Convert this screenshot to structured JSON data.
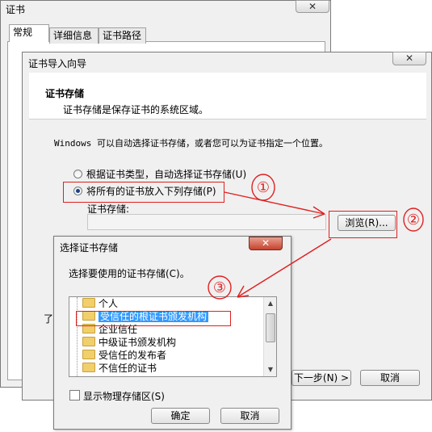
{
  "window_cert": {
    "title": "证书",
    "close_glyph": "✕",
    "tabs": [
      "常规",
      "详细信息",
      "证书路径"
    ]
  },
  "wizard": {
    "title": "证书导入向导",
    "close_glyph": "✕",
    "header_title": "证书存储",
    "header_desc": "证书存储是保存证书的系统区域。",
    "intro": "Windows 可以自动选择证书存储，或者您可以为证书指定一个位置。",
    "radio_auto": "根据证书类型，自动选择证书存储(U)",
    "radio_place": "将所有的证书放入下列存储(P)",
    "store_label": "证书存储:",
    "store_value": "",
    "browse_label": "浏览(R)...",
    "next_label": "下一步(N) >",
    "cancel_label": "取消",
    "partial_text": "了解"
  },
  "select_store": {
    "title": "选择证书存储",
    "close_glyph": "✕",
    "prompt": "选择要使用的证书存储(C)。",
    "tree_items": [
      "个人",
      "受信任的根证书颁发机构",
      "企业信任",
      "中级证书颁发机构",
      "受信任的发布者",
      "不信任的证书"
    ],
    "selected_index": 1,
    "checkbox_label": "显示物理存储区(S)",
    "ok_label": "确定",
    "cancel_label": "取消"
  },
  "annotations": {
    "color": "#e02020",
    "marks": [
      "①",
      "②",
      "③"
    ]
  },
  "icons": {
    "tree_node": "folder-icon",
    "scroll_up": "arrow-up-icon",
    "scroll_down": "arrow-down-icon",
    "close": "close-icon"
  }
}
